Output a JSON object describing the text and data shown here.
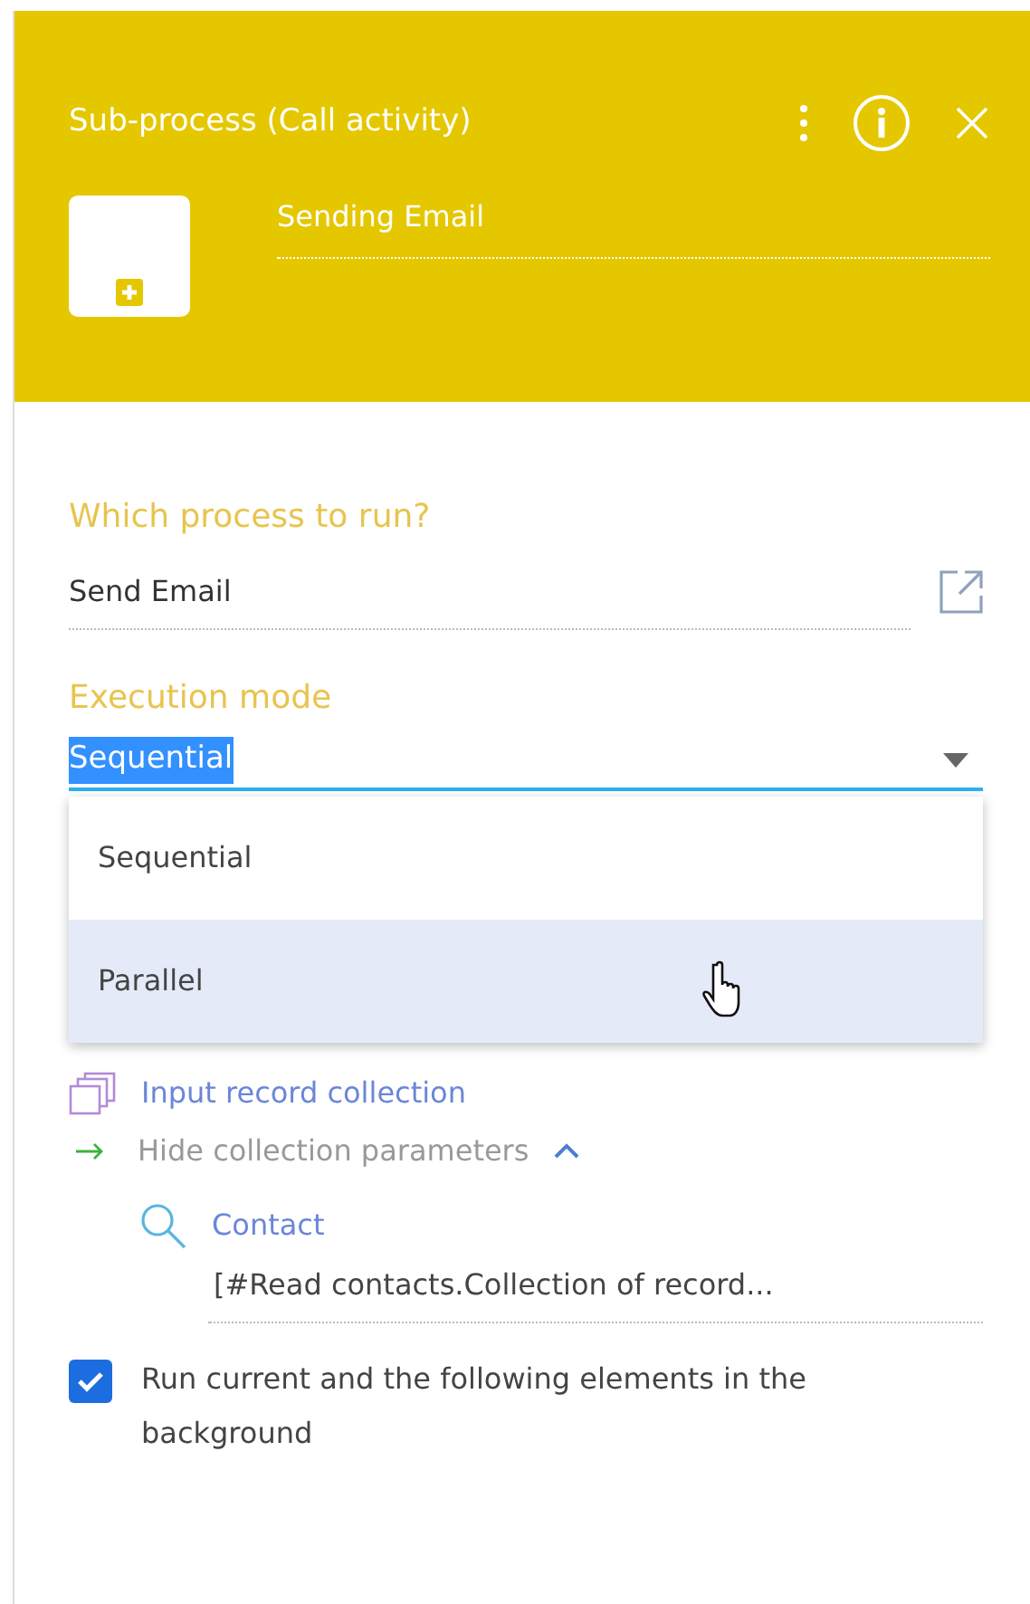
{
  "header": {
    "title": "Sub-process (Call activity)",
    "element_name": "Sending Email"
  },
  "process_field": {
    "label": "Which process to run?",
    "value": "Send Email"
  },
  "execution_mode": {
    "label": "Execution mode",
    "value": "Sequential",
    "expanded": true,
    "options": [
      {
        "label": "Sequential",
        "highlighted": false
      },
      {
        "label": "Parallel",
        "highlighted": true
      }
    ]
  },
  "collection": {
    "label": "Input record collection",
    "toggle": "Hide collection parameters",
    "expanded": true,
    "parameters": [
      {
        "label": "Contact",
        "value": "[#Read contacts.Collection of record..."
      }
    ]
  },
  "background_option": {
    "label": "Run current and the following elements in the background",
    "checked": true
  }
}
